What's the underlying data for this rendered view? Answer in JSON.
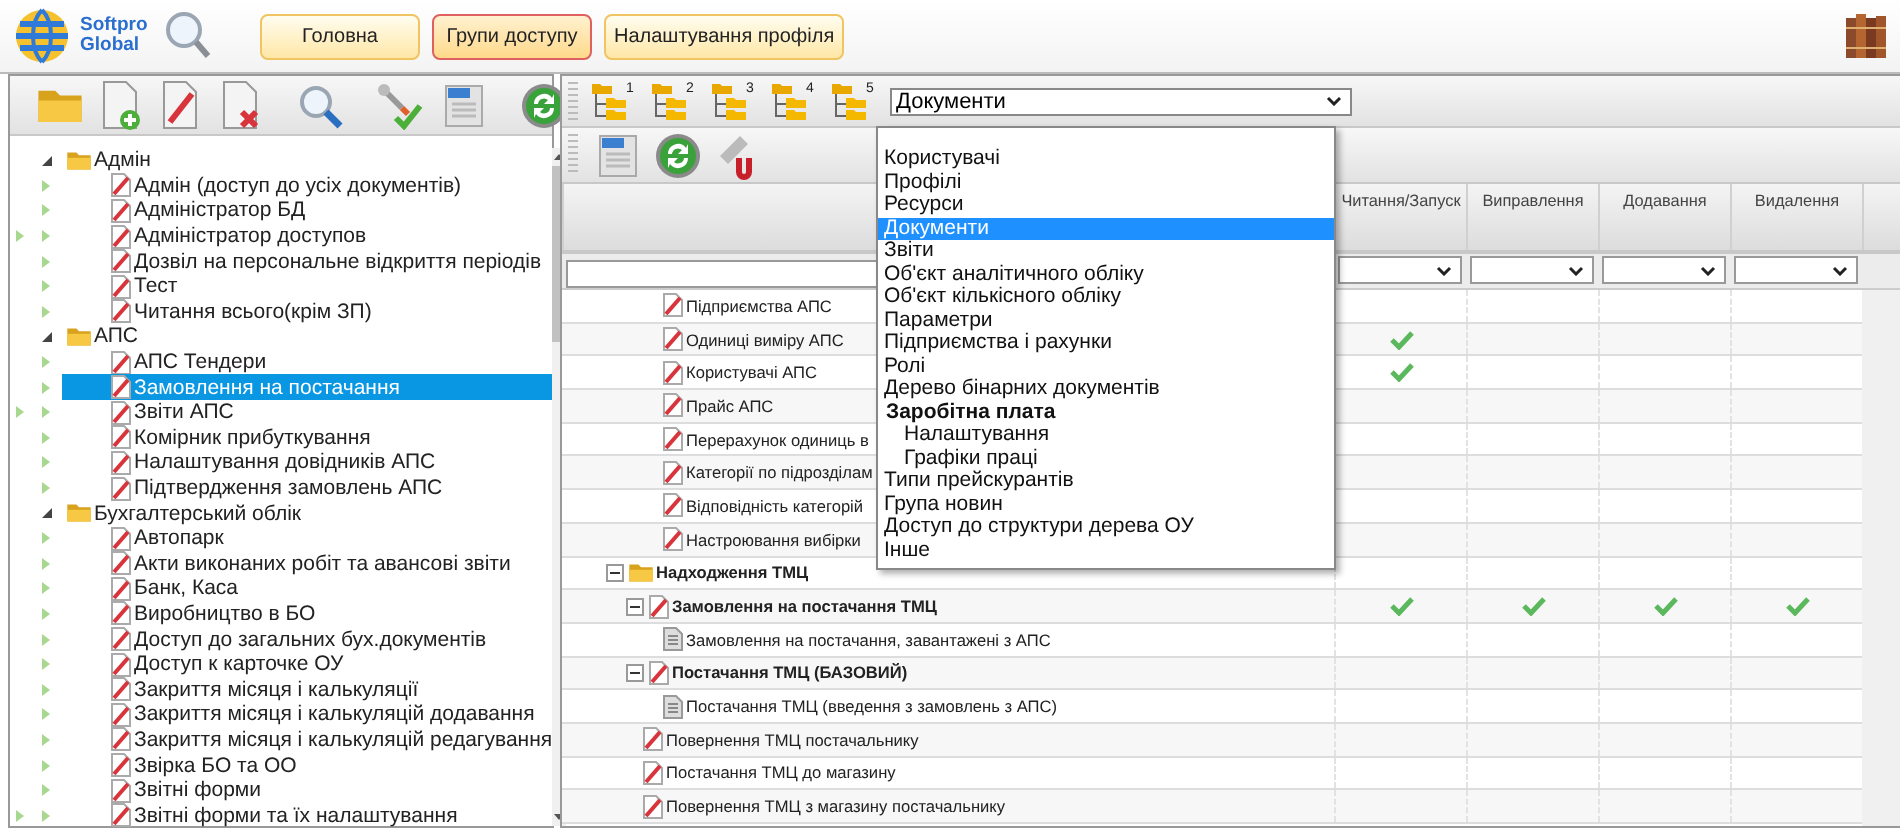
{
  "header": {
    "logo_text": "Softpro Global",
    "tabs": [
      {
        "label": "Головна",
        "selected": false
      },
      {
        "label": "Групи доступу",
        "selected": true
      },
      {
        "label": "Налаштування профіля",
        "selected": false
      }
    ]
  },
  "left_panel": {
    "tree": [
      {
        "label": "Адмін",
        "expanded": true,
        "selected": false,
        "children": [
          {
            "label": "Адмін (доступ до усіх документів)",
            "selected": false,
            "double_arrow": false
          },
          {
            "label": "Адміністратор БД",
            "selected": false,
            "double_arrow": false
          },
          {
            "label": "Адміністратор доступов",
            "selected": false,
            "double_arrow": true
          },
          {
            "label": "Дозвіл на персональне відкриття періодів",
            "selected": false,
            "double_arrow": false
          },
          {
            "label": "Тест",
            "selected": false,
            "double_arrow": false
          },
          {
            "label": "Читання всього(крім ЗП)",
            "selected": false,
            "double_arrow": false
          }
        ]
      },
      {
        "label": "АПС",
        "expanded": true,
        "selected": false,
        "children": [
          {
            "label": "АПС Тендери",
            "selected": false,
            "double_arrow": false
          },
          {
            "label": "Замовлення на постачання",
            "selected": true,
            "double_arrow": false
          },
          {
            "label": "Звіти АПС",
            "selected": false,
            "double_arrow": true
          },
          {
            "label": "Комірник прибуткування",
            "selected": false,
            "double_arrow": false
          },
          {
            "label": "Налаштування довідників АПС",
            "selected": false,
            "double_arrow": false
          },
          {
            "label": "Підтвердження замовлень АПС",
            "selected": false,
            "double_arrow": false
          }
        ]
      },
      {
        "label": "Бухгалтерський облік",
        "expanded": true,
        "selected": false,
        "children": [
          {
            "label": "Автопарк",
            "selected": false,
            "double_arrow": false
          },
          {
            "label": "Акти виконаних робіт та авансові звіти",
            "selected": false,
            "double_arrow": false
          },
          {
            "label": "Банк, Каса",
            "selected": false,
            "double_arrow": false
          },
          {
            "label": "Виробництво в БО",
            "selected": false,
            "double_arrow": false
          },
          {
            "label": "Доступ до загальних бух.документів",
            "selected": false,
            "double_arrow": false
          },
          {
            "label": "Доступ к карточке ОУ",
            "selected": false,
            "double_arrow": false
          },
          {
            "label": "Закриття місяця і калькуляції",
            "selected": false,
            "double_arrow": false
          },
          {
            "label": "Закриття місяця і калькуляцій додавання",
            "selected": false,
            "double_arrow": false
          },
          {
            "label": "Закриття місяця і калькуляцій редагування",
            "selected": false,
            "double_arrow": false
          },
          {
            "label": "Звірка БО та ОО",
            "selected": false,
            "double_arrow": false
          },
          {
            "label": "Звітні форми",
            "selected": false,
            "double_arrow": false
          },
          {
            "label": "Звітні форми та їх налаштування",
            "selected": false,
            "double_arrow": true
          }
        ]
      }
    ]
  },
  "right_panel": {
    "level_buttons": [
      "1",
      "2",
      "3",
      "4",
      "5"
    ],
    "type_select": {
      "value": "Документи",
      "options": [
        {
          "kind": "option",
          "label": "Користувачі",
          "selected": false
        },
        {
          "kind": "option",
          "label": "Профілі",
          "selected": false
        },
        {
          "kind": "option",
          "label": "Ресурси",
          "selected": false
        },
        {
          "kind": "option",
          "label": "Документи",
          "selected": true
        },
        {
          "kind": "option",
          "label": "Звіти",
          "selected": false
        },
        {
          "kind": "option",
          "label": "Об'єкт аналітичного обліку",
          "selected": false
        },
        {
          "kind": "option",
          "label": "Об'єкт кількісного обліку",
          "selected": false
        },
        {
          "kind": "option",
          "label": "Параметри",
          "selected": false
        },
        {
          "kind": "option",
          "label": "Підприємства і рахунки",
          "selected": false
        },
        {
          "kind": "option",
          "label": "Ролі",
          "selected": false
        },
        {
          "kind": "option",
          "label": "Дерево бінарних документів",
          "selected": false
        },
        {
          "kind": "group",
          "label": "Заробітна плата",
          "children": [
            {
              "kind": "option",
              "label": "Налаштування",
              "selected": false
            },
            {
              "kind": "option",
              "label": "Графіки праці",
              "selected": false
            }
          ]
        },
        {
          "kind": "option",
          "label": "Типи прейскурантів",
          "selected": false
        },
        {
          "kind": "option",
          "label": "Група новин",
          "selected": false
        },
        {
          "kind": "option",
          "label": "Доступ до структури дерева ОУ",
          "selected": false
        },
        {
          "kind": "option",
          "label": "Інше",
          "selected": false
        }
      ]
    },
    "table": {
      "columns": [
        "Читання/Запуск",
        "Виправлення",
        "Додавання",
        "Видалення"
      ],
      "rows": [
        {
          "children": [
            {
              "children": [
                {
                  "kind": "form",
                  "label": "Підприємства АПС",
                  "read": false,
                  "modify": false,
                  "add": false,
                  "remove": false
                },
                {
                  "kind": "form",
                  "label": "Одиниці виміру АПС",
                  "read": true,
                  "modify": false,
                  "add": false,
                  "remove": false
                },
                {
                  "kind": "form",
                  "label": "Користувачі АПС",
                  "read": true,
                  "modify": false,
                  "add": false,
                  "remove": false
                },
                {
                  "kind": "form",
                  "label": "Прайс АПС",
                  "read": false,
                  "modify": false,
                  "add": false,
                  "remove": false
                },
                {
                  "kind": "form",
                  "label": "Перерахунок одиниць в",
                  "read": false,
                  "modify": false,
                  "add": false,
                  "remove": false
                },
                {
                  "kind": "form",
                  "label": "Категорії по підрозділам",
                  "read": false,
                  "modify": false,
                  "add": false,
                  "remove": false
                },
                {
                  "kind": "form",
                  "label": "Відповідність категорій",
                  "read": false,
                  "modify": false,
                  "add": false,
                  "remove": false
                },
                {
                  "kind": "form",
                  "label": "Настроювання вибірки",
                  "read": false,
                  "modify": false,
                  "add": false,
                  "remove": false
                }
              ]
            }
          ]
        },
        {
          "kind": "folder",
          "label": "Надходження ТМЦ",
          "expanded": true,
          "read": false,
          "modify": false,
          "add": false,
          "remove": false,
          "children": [
            {
              "kind": "form",
              "label": "Замовлення на постачання ТМЦ",
              "expanded": true,
              "read": true,
              "modify": true,
              "add": true,
              "remove": true,
              "children": [
                {
                  "kind": "report",
                  "label": "Замовлення на постачання, завантажені з АПС",
                  "read": false,
                  "modify": false,
                  "add": false,
                  "remove": false
                }
              ]
            },
            {
              "kind": "form",
              "label": "Постачання ТМЦ (БАЗОВИЙ)",
              "expanded": true,
              "read": false,
              "modify": false,
              "add": false,
              "remove": false,
              "children": [
                {
                  "kind": "report",
                  "label": "Постачання ТМЦ (введення з замовлень з АПС)",
                  "read": false,
                  "modify": false,
                  "add": false,
                  "remove": false
                }
              ]
            },
            {
              "kind": "form",
              "label": "Повернення ТМЦ постачальнику",
              "read": false,
              "modify": false,
              "add": false,
              "remove": false
            },
            {
              "kind": "form",
              "label": "Постачання ТМЦ до магазину",
              "read": false,
              "modify": false,
              "add": false,
              "remove": false
            },
            {
              "kind": "form",
              "label": "Повернення ТМЦ з магазину постачальнику",
              "read": false,
              "modify": false,
              "add": false,
              "remove": false
            }
          ]
        }
      ]
    }
  }
}
